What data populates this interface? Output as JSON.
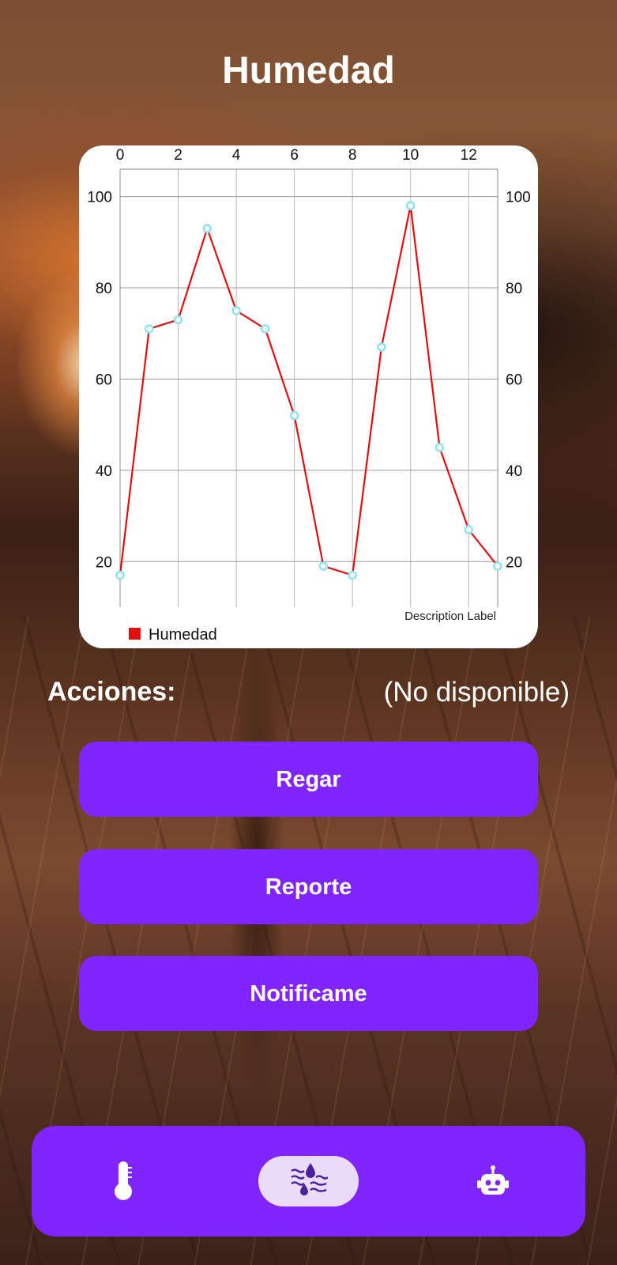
{
  "page": {
    "title": "Humedad"
  },
  "chart_data": {
    "type": "line",
    "x": [
      0,
      1,
      2,
      3,
      4,
      5,
      6,
      7,
      8,
      9,
      10,
      11,
      12,
      13
    ],
    "series": [
      {
        "name": "Humedad",
        "color": "#e01010",
        "values": [
          17,
          71,
          73,
          93,
          75,
          71,
          52,
          19,
          17,
          67,
          98,
          45,
          27,
          19
        ]
      }
    ],
    "x_ticks": [
      "0",
      "2",
      "4",
      "6",
      "8",
      "10",
      "12"
    ],
    "y_ticks": [
      "20",
      "40",
      "60",
      "80",
      "100"
    ],
    "xlim": [
      0,
      13
    ],
    "ylim": [
      10,
      106
    ],
    "x_axis_position": "top",
    "y_axis": "both sides",
    "grid": true,
    "description": "Description Label",
    "legend": {
      "position": "bottom-left",
      "entries": [
        "Humedad"
      ]
    },
    "marker_color": "#8fe3f0"
  },
  "actions": {
    "label": "Acciones:",
    "status": "(No disponible)",
    "buttons": [
      {
        "label": "Regar"
      },
      {
        "label": "Reporte"
      },
      {
        "label": "Notificame"
      }
    ]
  },
  "nav": {
    "items": [
      {
        "icon": "thermometer-icon",
        "active": false
      },
      {
        "icon": "water-humidity-icon",
        "active": true
      },
      {
        "icon": "robot-icon",
        "active": false
      }
    ]
  },
  "colors": {
    "accent": "#8025ff",
    "active_pill": "#eadcf8",
    "icon_dark": "#4b1fa0"
  }
}
